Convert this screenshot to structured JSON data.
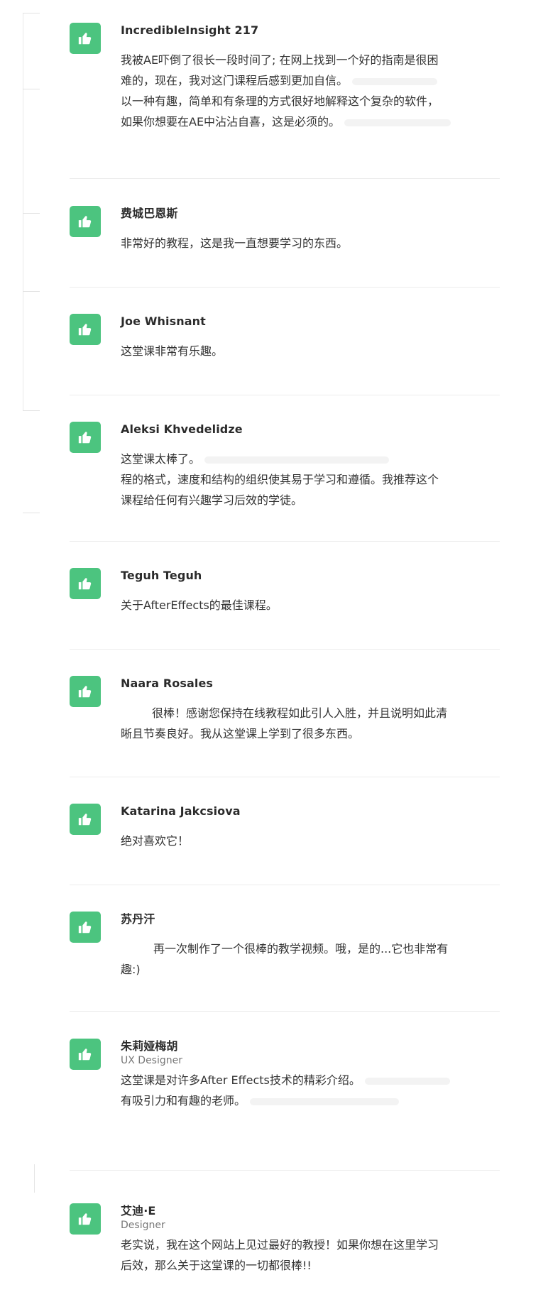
{
  "reviews": [
    {
      "name": "IncredibleInsight 217",
      "role": "",
      "lines": [
        "我被AE吓倒了很长一段时间了; 在网上找到一个好的指南是很困",
        "难的，现在，我对这门课程后感到更加自信。",
        "以一种有趣，简单和有条理的方式很好地解释这个复杂的软件，",
        "如果你想要在AE中沾沾自喜，这是必须的。"
      ]
    },
    {
      "name": "费城巴恩斯",
      "role": "",
      "lines": [
        "非常好的教程，这是我一直想要学习的东西。"
      ]
    },
    {
      "name": "Joe Whisnant",
      "role": "",
      "lines": [
        "这堂课非常有乐趣。"
      ]
    },
    {
      "name": "Aleksi Khvedelidze",
      "role": "",
      "lines": [
        "这堂课太棒了。",
        "程的格式，速度和结构的组织使其易于学习和遵循。我推荐这个",
        "课程给任何有兴趣学习后效的学徒。"
      ]
    },
    {
      "name": "Teguh Teguh",
      "role": "",
      "lines": [
        "关于AfterEffects的最佳课程。"
      ]
    },
    {
      "name": "Naara Rosales",
      "role": "",
      "lines": [
        "很棒！感谢您保持在线教程如此引人入胜，并且说明如此清",
        "晰且节奏良好。我从这堂课上学到了很多东西。"
      ]
    },
    {
      "name": "Katarina Jakcsiova",
      "role": "",
      "lines": [
        "绝对喜欢它！"
      ]
    },
    {
      "name": "苏丹汗",
      "role": "",
      "lines": [
        "再一次制作了一个很棒的教学视频。哦，是的...它也非常有",
        "趣:)"
      ]
    },
    {
      "name": "朱莉娅梅胡",
      "role": "UX Designer",
      "lines": [
        "这堂课是对许多After Effects技术的精彩介绍。",
        "有吸引力和有趣的老师。"
      ]
    },
    {
      "name": "艾迪·E",
      "role": "Designer",
      "lines": [
        "老实说，我在这个网站上见过最好的教授！如果你想在这里学习",
        "后效，那么关于这堂课的一切都很棒!!"
      ]
    }
  ],
  "icons": {
    "review_icon": "thumbs-up-icon",
    "badge_color": "#4cc47f"
  }
}
